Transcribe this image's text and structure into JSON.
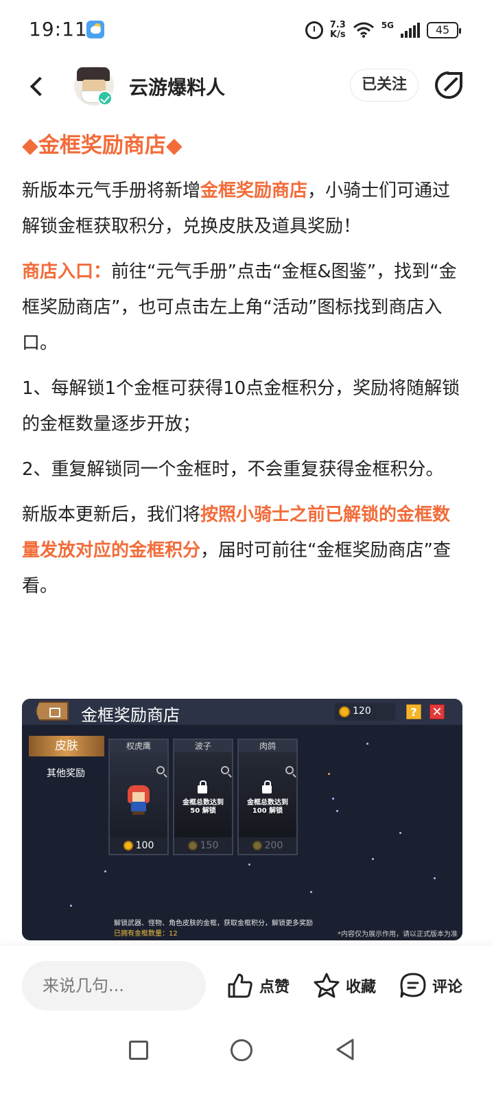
{
  "status_bar": {
    "time": "19:11",
    "net_speed_value": "7.3",
    "net_speed_unit": "K/s",
    "network": "5G",
    "battery": "45"
  },
  "header": {
    "author_name": "云游爆料人",
    "follow_label": "已关注"
  },
  "article": {
    "title": "◆金框奖励商店◆",
    "p1_before": "新版本元气手册将新增",
    "p1_highlight": "金框奖励商店",
    "p1_after": "，小骑士们可通过解锁金框获取积分，兑换皮肤及道具奖励！",
    "p2_label": "商店入口：",
    "p2_text": "前往“元气手册”点击“金框&图鉴”，找到“金框奖励商店”，也可点击左上角“活动”图标找到商店入口。",
    "p3": "1、每解锁1个金框可获得10点金框积分，奖励将随解锁的金框数量逐步开放；",
    "p4": "2、重复解锁同一个金框时，不会重复获得金框积分。",
    "p5_before": "新版本更新后，我们将",
    "p5_highlight": "按照小骑士之前已解锁的金框数量发放对应的金框积分",
    "p5_after": "，届时可前往“金框奖励商店”查看。"
  },
  "game_image": {
    "title": "金框奖励商店",
    "coins": "120",
    "help_label": "?",
    "close_label": "✕",
    "tab_skin": "皮肤",
    "tab_other": "其他奖励",
    "cards": [
      {
        "name": "权虎鹰",
        "price": "100",
        "locked": false,
        "lock_text": ""
      },
      {
        "name": "波子",
        "price": "150",
        "locked": true,
        "lock_text": "金框总数达到 50 解锁"
      },
      {
        "name": "肉鸽",
        "price": "200",
        "locked": true,
        "lock_text": "金框总数达到 100 解锁"
      }
    ],
    "footer_desc": "解锁武器、怪物、角色皮肤的金框，获取金框积分，解锁更多奖励",
    "footer_owned": "已拥有金框数量：12",
    "footer_note": "*内容仅为展示作用，请以正式版本为准"
  },
  "bottom_bar": {
    "comment_placeholder": "来说几句...",
    "like_label": "点赞",
    "fav_label": "收藏",
    "comment_label": "评论"
  },
  "icons": {
    "back": "back-arrow-icon",
    "share": "share-icon",
    "like": "thumbs-up-icon",
    "fav": "star-icon",
    "comment": "comment-bubble-icon"
  },
  "colors": {
    "accent": "#f26c3a",
    "verified": "#2ec4a0"
  }
}
